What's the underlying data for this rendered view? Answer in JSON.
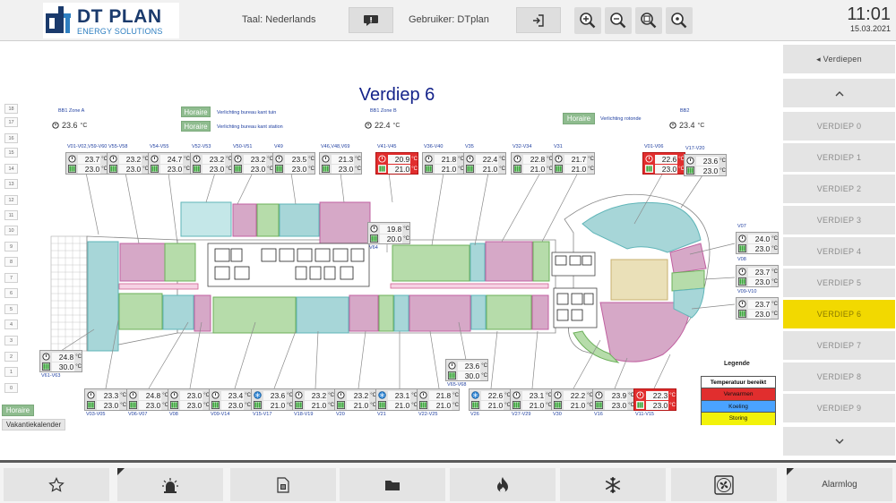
{
  "header": {
    "logo_name": "DT PLAN",
    "logo_sub": "ENERGY SOLUTIONS",
    "language_label": "Taal: Nederlands",
    "user_label": "Gebruiker: DTplan",
    "time": "11:01",
    "date": "15.03.2021",
    "icons": [
      "chat-icon",
      "logout-icon",
      "zoom-in-icon",
      "zoom-out-icon",
      "zoom-fit-icon",
      "zoom-reset-icon"
    ]
  },
  "nav": {
    "back_label": "◂ Verdiepen",
    "floors": [
      "VERDIEP 0",
      "VERDIEP 1",
      "VERDIEP 2",
      "VERDIEP 3",
      "VERDIEP 4",
      "VERDIEP 5",
      "VERDIEP 6",
      "VERDIEP 7",
      "VERDIEP 8",
      "VERDIEP 9"
    ],
    "active_floor": "VERDIEP 6"
  },
  "floor": {
    "title": "Verdiep 6",
    "levels": [
      "18",
      "17",
      "16",
      "15",
      "14",
      "13",
      "12",
      "11",
      "10",
      "9",
      "8",
      "7",
      "6",
      "5",
      "4",
      "3",
      "2",
      "1",
      "0"
    ]
  },
  "schedules": [
    {
      "button": "Horaire",
      "label": "Verlichting bureau kant tuin"
    },
    {
      "button": "Horaire",
      "label": "Verlichting bureau kant station"
    },
    {
      "button": "Horaire",
      "label": "Verlichting rotonde"
    }
  ],
  "zones": [
    {
      "name": "BB1 Zone A",
      "temp": "23.6",
      "unit": "°C"
    },
    {
      "name": "BB1 Zone B",
      "temp": "22.4",
      "unit": "°C"
    },
    {
      "name": "BB2",
      "temp": "23.4",
      "unit": "°C"
    }
  ],
  "left_buttons": {
    "horaire": "Horaire",
    "vakantiekalender": "Vakantiekalender"
  },
  "unit": "°C",
  "sensors": [
    {
      "label": "V01-V02,V59-V60",
      "t": "23.7",
      "s": "23.0",
      "alarm": false
    },
    {
      "label": "V55-V58",
      "t": "23.2",
      "s": "23.0",
      "alarm": false
    },
    {
      "label": "V54-V55",
      "t": "24.7",
      "s": "23.0",
      "alarm": false
    },
    {
      "label": "V52-V53",
      "t": "23.2",
      "s": "23.0",
      "alarm": false
    },
    {
      "label": "V50-V51",
      "t": "23.2",
      "s": "23.0",
      "alarm": false
    },
    {
      "label": "V49",
      "t": "23.5",
      "s": "23.0",
      "alarm": false
    },
    {
      "label": "V46,V48,V69",
      "t": "21.3",
      "s": "23.0",
      "alarm": false
    },
    {
      "label": "V41-V45",
      "t": "20.9",
      "s": "21.0",
      "alarm": true
    },
    {
      "label": "V36-V40",
      "t": "21.8",
      "s": "21.0",
      "alarm": false
    },
    {
      "label": "V35",
      "t": "22.4",
      "s": "21.0",
      "alarm": false
    },
    {
      "label": "V32-V34",
      "t": "22.8",
      "s": "21.0",
      "alarm": false
    },
    {
      "label": "V31",
      "t": "21.7",
      "s": "21.0",
      "alarm": false
    },
    {
      "label": "V01-V06",
      "t": "22.6",
      "s": "23.0",
      "alarm": true
    },
    {
      "label": "V17-V20",
      "t": "23.6",
      "s": "23.0",
      "alarm": false
    },
    {
      "label": "V64",
      "t": "19.8",
      "s": "20.0",
      "alarm": false
    },
    {
      "label": "V07",
      "t": "24.0",
      "s": "23.0",
      "alarm": false
    },
    {
      "label": "V08",
      "t": "23.7",
      "s": "23.0",
      "alarm": false
    },
    {
      "label": "V09-V10",
      "t": "23.7",
      "s": "23.0",
      "alarm": false
    },
    {
      "label": "V61-V63",
      "t": "24.8",
      "s": "30.0",
      "alarm": false
    },
    {
      "label": "V65-V68",
      "t": "23.6",
      "s": "30.0",
      "alarm": false
    },
    {
      "label": "V03-V05",
      "t": "23.3",
      "s": "23.0",
      "alarm": false
    },
    {
      "label": "V06-V07",
      "t": "24.8",
      "s": "23.0",
      "alarm": false
    },
    {
      "label": "V08",
      "t": "23.0",
      "s": "23.0",
      "alarm": false
    },
    {
      "label": "V09-V14",
      "t": "23.4",
      "s": "23.0",
      "alarm": false
    },
    {
      "label": "V15-V17",
      "t": "23.6",
      "s": "21.0",
      "alarm": false
    },
    {
      "label": "V18-V19",
      "t": "23.2",
      "s": "21.0",
      "alarm": false
    },
    {
      "label": "V20",
      "t": "23.2",
      "s": "21.0",
      "alarm": false
    },
    {
      "label": "V21",
      "t": "23.1",
      "s": "21.0",
      "alarm": false
    },
    {
      "label": "V22-V25",
      "t": "21.8",
      "s": "21.0",
      "alarm": false
    },
    {
      "label": "V26",
      "t": "22.6",
      "s": "21.0",
      "alarm": false
    },
    {
      "label": "V27-V29",
      "t": "23.1",
      "s": "21.0",
      "alarm": false
    },
    {
      "label": "V30",
      "t": "22.2",
      "s": "21.0",
      "alarm": false
    },
    {
      "label": "V16",
      "t": "23.9",
      "s": "23.0",
      "alarm": false
    },
    {
      "label": "V11-V15",
      "t": "22.3",
      "s": "23.0",
      "alarm": true
    }
  ],
  "legend": {
    "title": "Legende",
    "header": "Temperatuur bereikt",
    "items": [
      {
        "label": "Verwarmen",
        "color": "#e12e2e"
      },
      {
        "label": "Koeling",
        "color": "#4aa3ff"
      },
      {
        "label": "Storing",
        "color": "#f2f20a"
      }
    ]
  },
  "footer": {
    "alarmlog_label": "Alarmlog",
    "icons": [
      "star-icon",
      "alarm-light-icon",
      "document-icon",
      "folder-icon",
      "flame-icon",
      "snowflake-icon",
      "fan-icon"
    ]
  }
}
